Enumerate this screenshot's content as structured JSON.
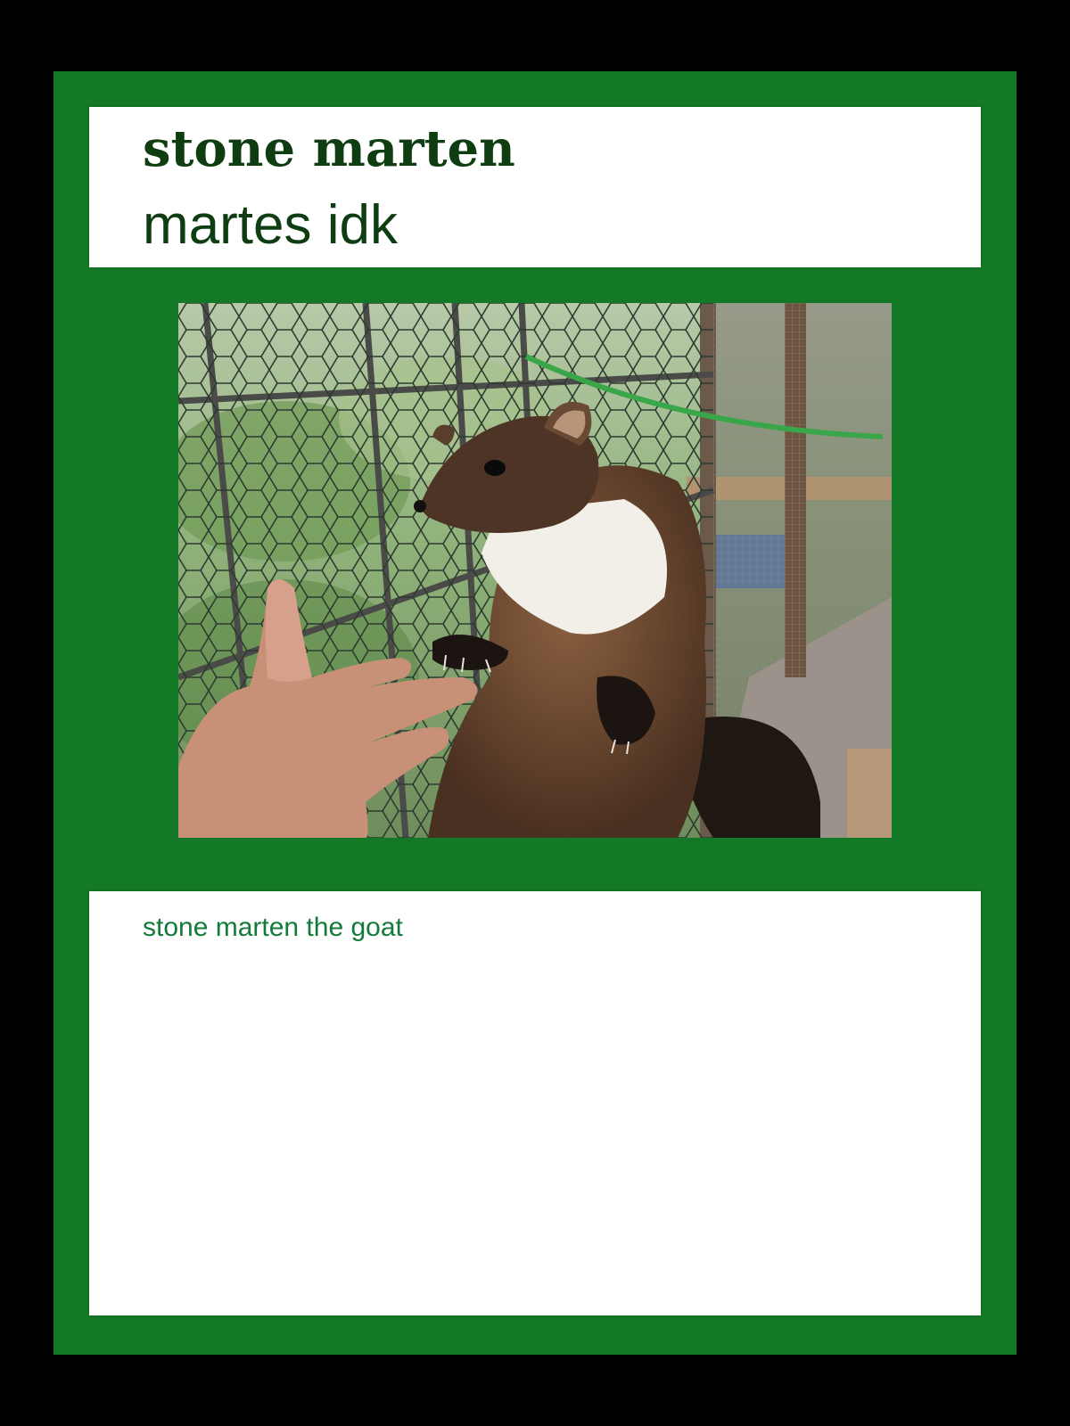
{
  "card": {
    "common_name": "stone marten",
    "scientific_name": "martes idk",
    "description": "stone marten the goat"
  },
  "colors": {
    "frame": "#000000",
    "card_background": "#137926",
    "panel_background": "#ffffff",
    "title_text": "#0f3d12",
    "description_text": "#137a3a"
  }
}
